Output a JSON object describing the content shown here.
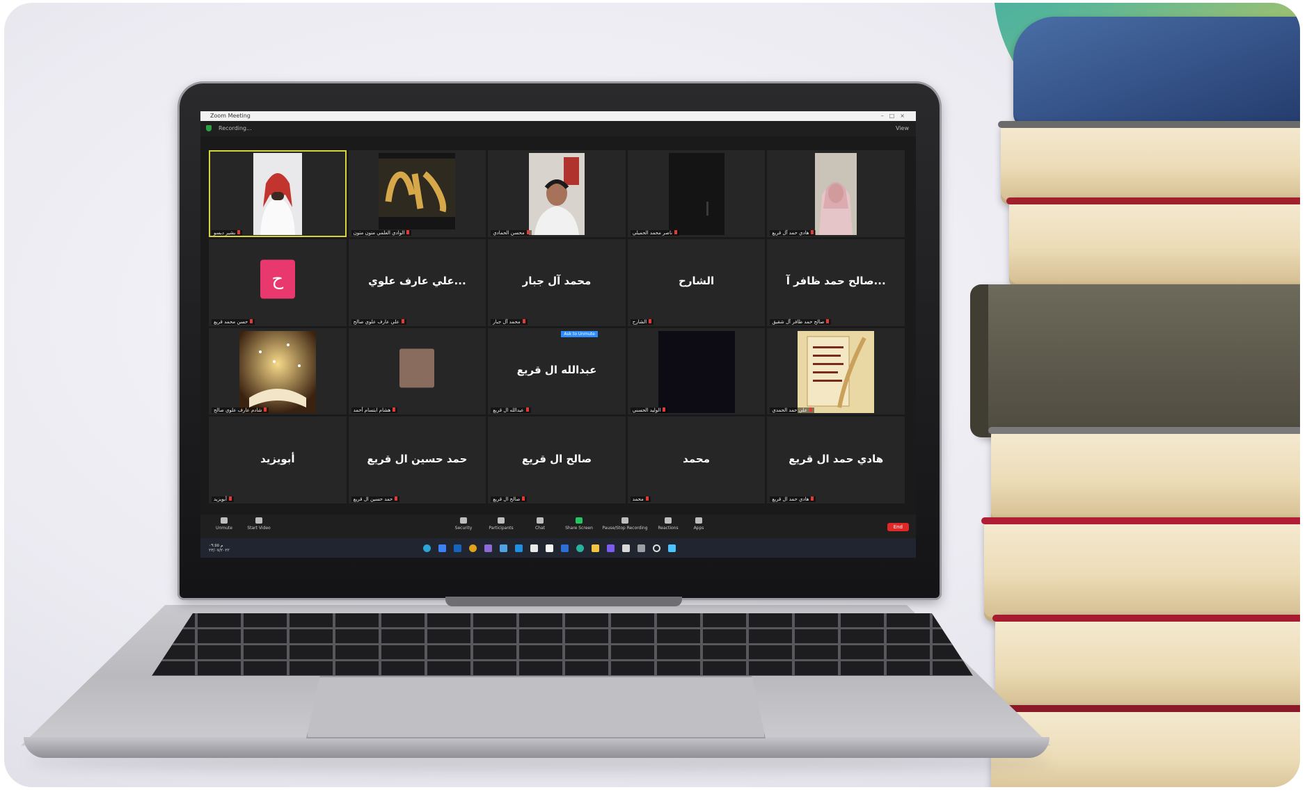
{
  "window": {
    "title": "Zoom Meeting",
    "recording": "Recording...",
    "view": "View"
  },
  "tiles": [
    {
      "big": "",
      "label": "بشير دبسو"
    },
    {
      "big": "",
      "label": "الوادي العلمي متون متون"
    },
    {
      "big": "",
      "label": "محسن الحمادي"
    },
    {
      "big": "",
      "label": "ناصر محمد الحميلي"
    },
    {
      "big": "",
      "label": "هادي حمد آل قريع"
    },
    {
      "big": "ح",
      "label": "حسن محمد قريع"
    },
    {
      "big": "...علي عارف علوي",
      "label": "علي عارف علوي صالح"
    },
    {
      "big": "محمد آل جبار",
      "label": "محمد آل جبار"
    },
    {
      "big": "الشارح",
      "label": "الشارح"
    },
    {
      "big": "...صالح حمد ظافر آ",
      "label": "صالح حمد ظافر آل شقيق"
    },
    {
      "big": "",
      "label": "شادم عارف علوي صالح"
    },
    {
      "big": "",
      "label": "هشام ابتسام أحمد"
    },
    {
      "big": "عبدالله ال قريع",
      "label": "عبدالله ال قريع"
    },
    {
      "big": "",
      "label": "الوليد الحسني"
    },
    {
      "big": "",
      "label": "علي حمد الحمدي"
    },
    {
      "big": "أبويزيد",
      "label": "أبويزيد"
    },
    {
      "big": "حمد حسين ال قريع",
      "label": "حمد حسين ال قريع"
    },
    {
      "big": "صالح ال قريع",
      "label": "صالح ال قريع"
    },
    {
      "big": "محمد",
      "label": "محمد"
    },
    {
      "big": "هادي حمد ال قريع",
      "label": "هادي حمد ال قريع"
    }
  ],
  "ask_to_unmute": "Ask to Unmute",
  "toolbar": {
    "unmute": "Unmute",
    "start_video": "Start Video",
    "security": "Security",
    "participants": "Participants",
    "chat": "Chat",
    "share_screen": "Share Screen",
    "pause_stop_recording": "Pause/Stop Recording",
    "reactions": "Reactions",
    "apps": "Apps",
    "end": "End"
  },
  "taskbar": {
    "time": "م ٠٩:٥٥",
    "date": "٢٣/٠٧/٢٠٢٢"
  },
  "colors": {
    "active_speaker": "#d6d63a",
    "avatar_pink": "#e8386d",
    "end_red": "#e02828",
    "share_green": "#22c55e"
  }
}
